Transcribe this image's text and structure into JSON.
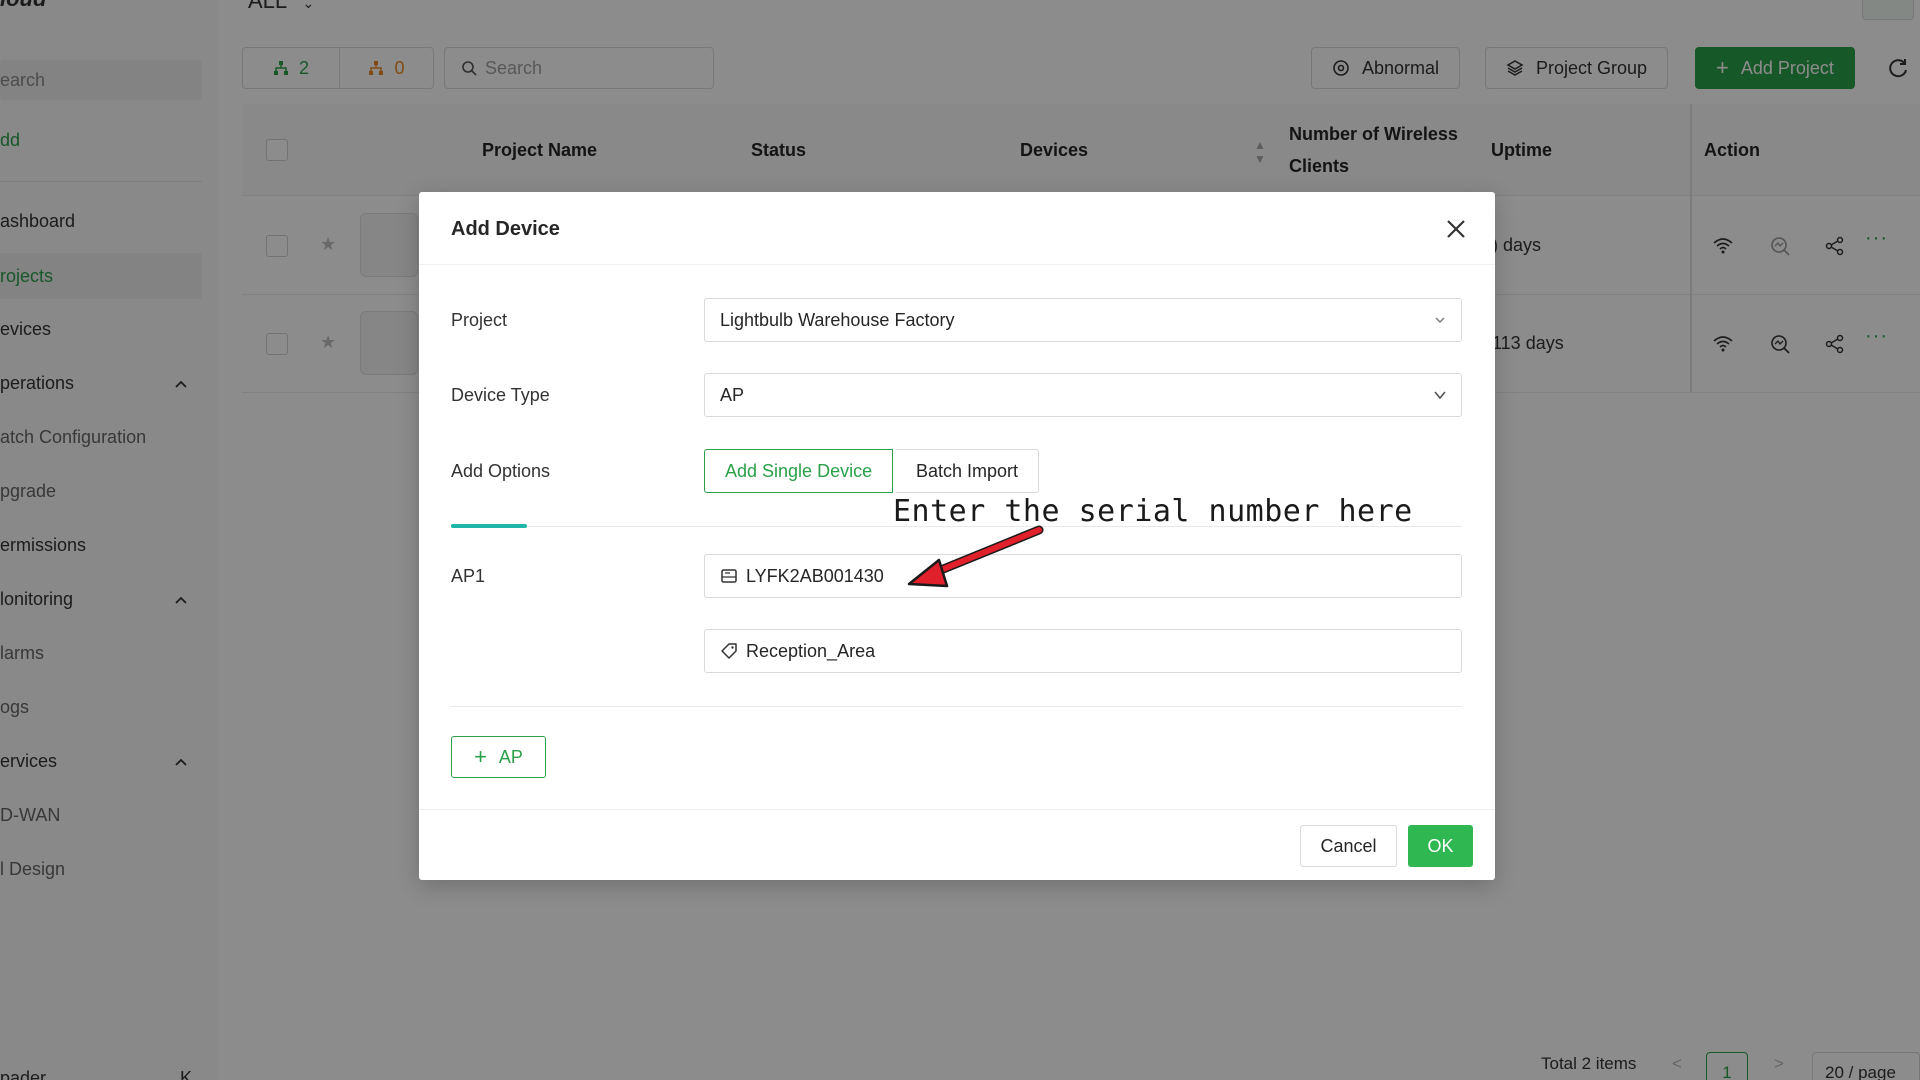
{
  "sidebar": {
    "logo": "loud",
    "search_placeholder": "earch",
    "add_label": "dd",
    "items": [
      {
        "label": "ashboard"
      },
      {
        "label": "rojects"
      },
      {
        "label": "evices"
      },
      {
        "label": "perations"
      },
      {
        "label": "atch Configuration"
      },
      {
        "label": "pgrade"
      },
      {
        "label": "ermissions"
      },
      {
        "label": "lonitoring"
      },
      {
        "label": "larms"
      },
      {
        "label": "ogs"
      },
      {
        "label": "ervices"
      },
      {
        "label": "D-WAN"
      },
      {
        "label": "l Design"
      }
    ],
    "bottom_label": "pader",
    "collapse_glyph": "K"
  },
  "main": {
    "scope_label": "ALL",
    "counter_online": "2",
    "counter_offline": "0",
    "search_placeholder": "Search",
    "buttons": {
      "abnormal": "Abnormal",
      "project_group": "Project Group",
      "add_project": "Add Project"
    },
    "table": {
      "headers": {
        "project_name": "Project Name",
        "status": "Status",
        "devices": "Devices",
        "wireless_clients_1": "Number of Wireless",
        "wireless_clients_2": "Clients",
        "uptime": "Uptime",
        "action": "Action"
      },
      "rows": [
        {
          "uptime": ") days"
        },
        {
          "uptime": "113 days"
        }
      ]
    },
    "pagination": {
      "total": "Total 2 items",
      "page": "1",
      "page_size": "20 / page"
    }
  },
  "modal": {
    "title": "Add Device",
    "project_label": "Project",
    "project_value": "Lightbulb Warehouse Factory",
    "device_type_label": "Device Type",
    "device_type_value": "AP",
    "add_options_label": "Add Options",
    "option_single": "Add Single Device",
    "option_batch": "Batch Import",
    "annotation": "Enter the serial number here",
    "entry_label": "AP1",
    "serial_value": "LYFK2AB001430",
    "location_value": "Reception_Area",
    "add_more_label": "AP",
    "cancel_label": "Cancel",
    "ok_label": "OK"
  },
  "colors": {
    "primary": "#2aa149",
    "ok_button": "#2fb752",
    "warning": "#e8891f",
    "annotation_arrow": "#e0202a",
    "tab_ink": "#1fb5a8"
  }
}
